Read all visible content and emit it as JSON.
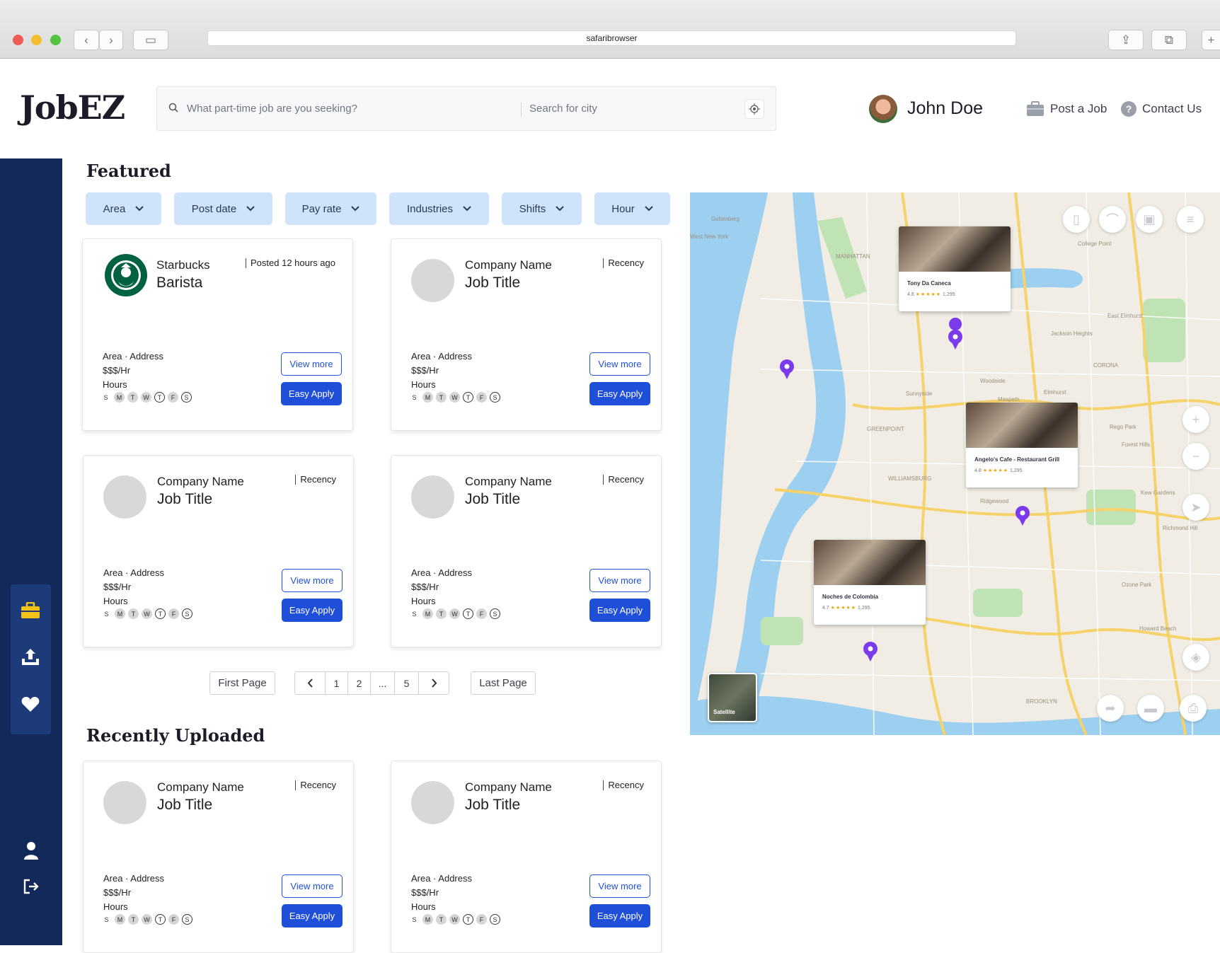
{
  "browser": {
    "url": "safaribrowser"
  },
  "header": {
    "logo": "JobEZ",
    "search_placeholder": "What part-time job are you seeking?",
    "city_placeholder": "Search for city",
    "user_name": "John Doe",
    "post_job": "Post a Job",
    "contact_us": "Contact Us"
  },
  "featured": {
    "title": "Featured",
    "filters": [
      {
        "label": "Area"
      },
      {
        "label": "Post date"
      },
      {
        "label": "Pay rate"
      },
      {
        "label": "Industries"
      },
      {
        "label": "Shifts"
      },
      {
        "label": "Hour"
      }
    ],
    "cards": [
      {
        "company": "Starbucks",
        "title": "Barista",
        "recency": "Posted 12 hours ago",
        "address": "Area · Address",
        "pay": "$$$/Hr",
        "hours": "Hours",
        "view": "View more",
        "apply": "Easy Apply"
      },
      {
        "company": "Company Name",
        "title": "Job Title",
        "recency": "Recency",
        "address": "Area · Address",
        "pay": "$$$/Hr",
        "hours": "Hours",
        "view": "View more",
        "apply": "Easy Apply"
      },
      {
        "company": "Company Name",
        "title": "Job Title",
        "recency": "Recency",
        "address": "Area · Address",
        "pay": "$$$/Hr",
        "hours": "Hours",
        "view": "View more",
        "apply": "Easy Apply"
      },
      {
        "company": "Company Name",
        "title": "Job Title",
        "recency": "Recency",
        "address": "Area · Address",
        "pay": "$$$/Hr",
        "hours": "Hours",
        "view": "View more",
        "apply": "Easy Apply"
      }
    ]
  },
  "days": [
    "S",
    "M",
    "T",
    "W",
    "T",
    "F",
    "S"
  ],
  "pagination": {
    "first": "First Page",
    "pages": [
      "1",
      "2",
      "...",
      "5"
    ],
    "last": "Last Page"
  },
  "recent": {
    "title": "Recently Uploaded",
    "cards": [
      {
        "company": "Company Name",
        "title": "Job Title",
        "recency": "Recency",
        "address": "Area · Address",
        "pay": "$$$/Hr",
        "hours": "Hours",
        "view": "View more",
        "apply": "Easy Apply"
      },
      {
        "company": "Company Name",
        "title": "Job Title",
        "recency": "Recency",
        "address": "Area · Address",
        "pay": "$$$/Hr",
        "hours": "Hours",
        "view": "View more",
        "apply": "Easy Apply"
      }
    ]
  },
  "map": {
    "places": [
      {
        "name": "Tony Da Caneca",
        "rating": "4.8",
        "reviews": "1,295"
      },
      {
        "name": "Angelo's Cafe - Restaurant Grill",
        "rating": "4.8",
        "reviews": "1,295"
      },
      {
        "name": "Noches de Colombia",
        "rating": "4.7",
        "reviews": "1,295"
      }
    ],
    "satellite": "Satellite",
    "labels": [
      "Guttenberg",
      "West New York",
      "MANHATTAN",
      "Jackson Heights",
      "East Elmhurst",
      "Sunnyside",
      "Woodside",
      "Maspeth",
      "Elmhurst",
      "Rego Park",
      "Forest Hills",
      "Ridgewood",
      "Kew Gardens",
      "Richmond Hill",
      "Ozone Park",
      "Howard Beach",
      "BROOKLYN",
      "College Point",
      "CORONA",
      "GREENPOINT",
      "WILLIAMSBURG"
    ]
  },
  "colors": {
    "sidebar": "#13295a",
    "accent": "#1f4fd9",
    "filter": "#cfe3fb",
    "pin": "#7c3aed"
  }
}
